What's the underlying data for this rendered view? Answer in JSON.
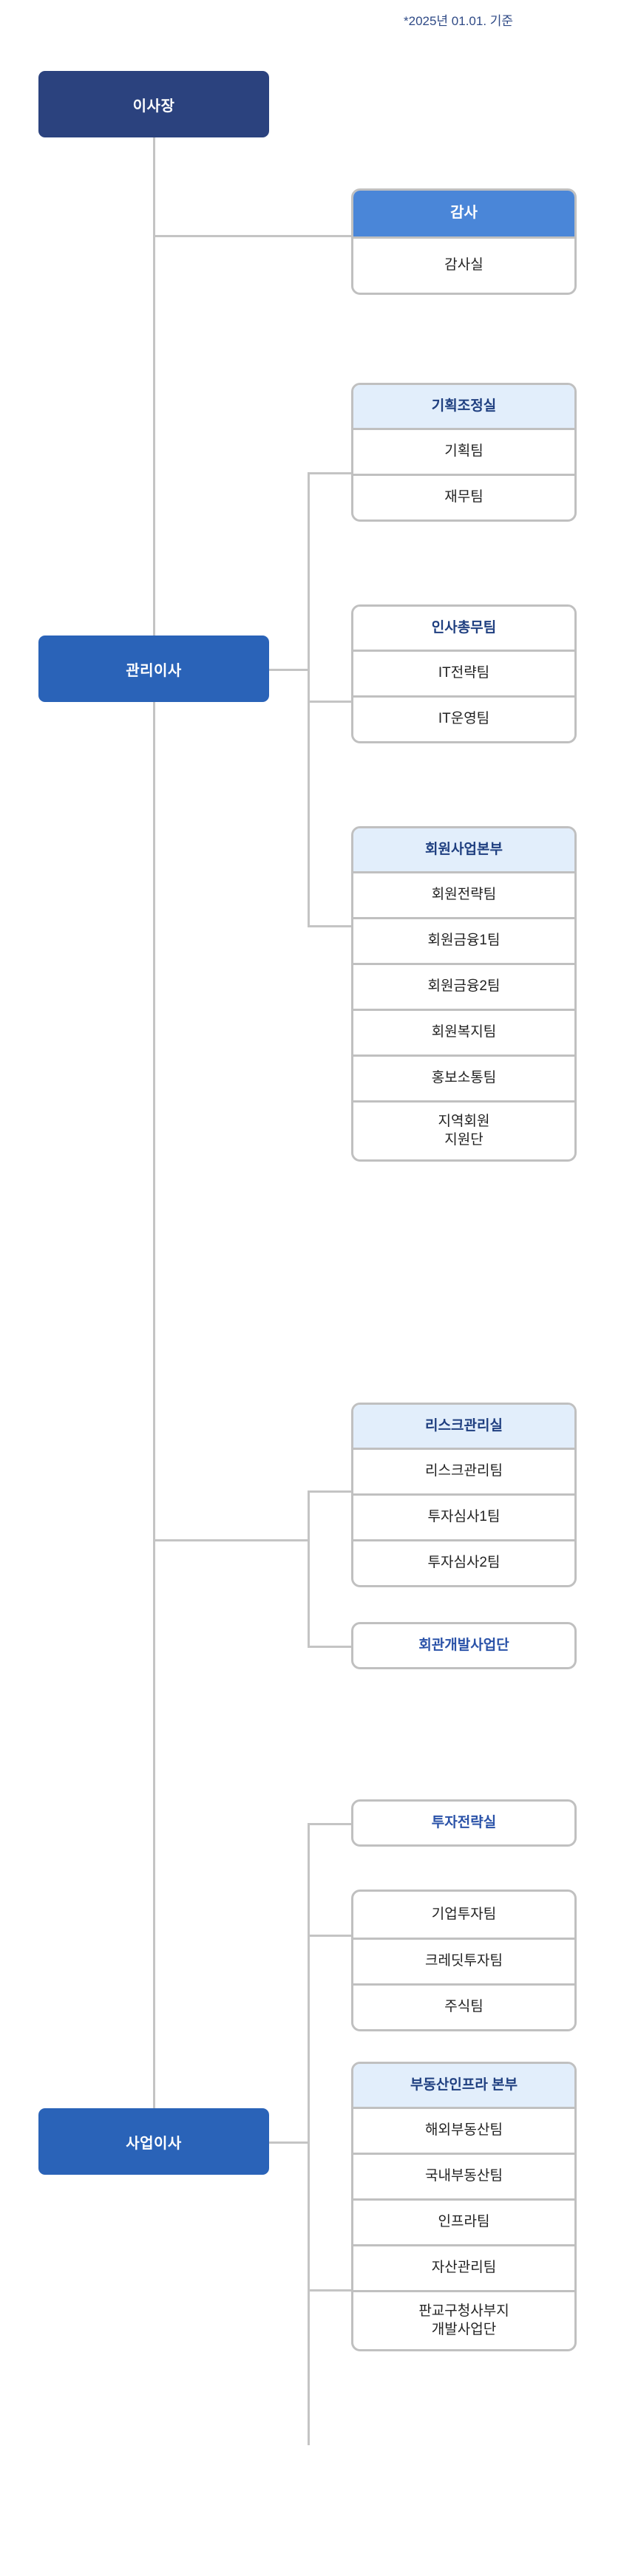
{
  "footnote": "*2025년 01.01. 기준",
  "colors": {
    "chairman_fill": "#2b427e",
    "director_fill": "#2a63b8",
    "audit_head_fill": "#4a86d8",
    "tint_head_fill": "#e2eefb",
    "head_text_blue": "#1f3f80",
    "solo_text_blue": "#2a52a8",
    "line": "#c4c4c4",
    "border": "#c0c0c0"
  },
  "chairman": {
    "label": "이사장"
  },
  "directors": [
    {
      "key": "management",
      "label": "관리이사"
    },
    {
      "key": "business",
      "label": "사업이사"
    }
  ],
  "groups": {
    "audit": {
      "head": "감사",
      "head_style": "solid",
      "items": [
        "감사실"
      ]
    },
    "planning": {
      "head": "기획조정실",
      "head_style": "tint",
      "items": [
        "기획팀",
        "재무팀"
      ]
    },
    "hr": {
      "head": "인사총무팀",
      "head_style": "plain",
      "items": [
        "IT전략팀",
        "IT운영팀"
      ]
    },
    "member": {
      "head": "회원사업본부",
      "head_style": "tint",
      "items": [
        "회원전략팀",
        "회원금융1팀",
        "회원금융2팀",
        "회원복지팀",
        "홍보소통팀",
        "지역회원\n지원단"
      ]
    },
    "risk": {
      "head": "리스크관리실",
      "head_style": "tint",
      "items": [
        "리스크관리팀",
        "투자심사1팀",
        "투자심사2팀"
      ]
    },
    "invest_teams": {
      "head": null,
      "head_style": null,
      "items": [
        "기업투자팀",
        "크레딧투자팀",
        "주식팀"
      ]
    },
    "realestate": {
      "head": "부동산인프라 본부",
      "head_style": "tint",
      "items": [
        "해외부동산팀",
        "국내부동산팀",
        "인프라팀",
        "자산관리팀",
        "판교구청사부지\n개발사업단"
      ]
    }
  },
  "solos": {
    "hall_dev": {
      "label": "회관개발사업단"
    },
    "invest_strategy": {
      "label": "투자전략실"
    }
  }
}
